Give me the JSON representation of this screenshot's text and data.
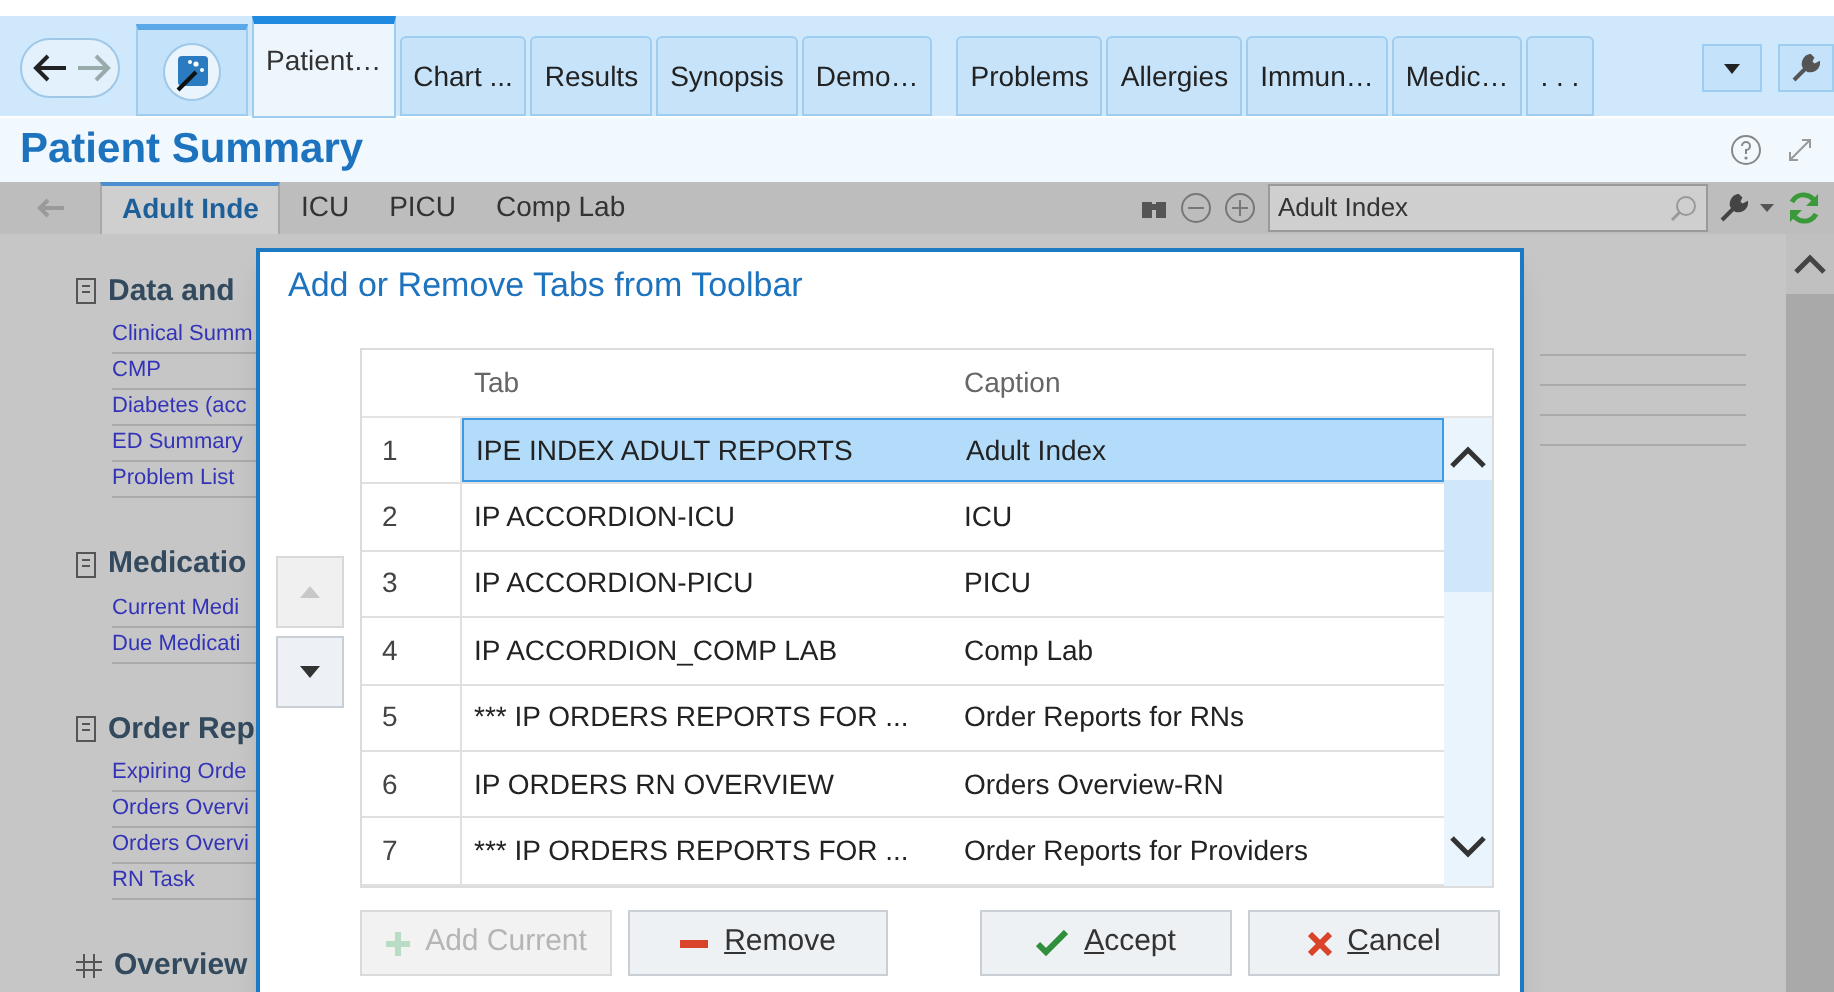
{
  "top_tabs": [
    {
      "label": "Patient…",
      "selected": true
    },
    {
      "label": "Chart ...",
      "selected": false
    },
    {
      "label": "Results",
      "selected": false
    },
    {
      "label": "Synopsis",
      "selected": false
    },
    {
      "label": "Demo…",
      "selected": false
    },
    {
      "label": "Problems",
      "selected": false
    },
    {
      "label": "Allergies",
      "selected": false
    },
    {
      "label": "Immun…",
      "selected": false
    },
    {
      "label": "Medic…",
      "selected": false
    },
    {
      "label": ". . .",
      "selected": false
    }
  ],
  "page_title": "Patient Summary",
  "sub_tabs": [
    {
      "label": "Adult Inde",
      "selected": true
    },
    {
      "label": "ICU",
      "selected": false
    },
    {
      "label": "PICU",
      "selected": false
    },
    {
      "label": "Comp Lab",
      "selected": false
    }
  ],
  "search": {
    "value": "Adult Index"
  },
  "sections": [
    {
      "title": "Data and",
      "kind": "document",
      "links": [
        "Clinical Summ",
        "CMP",
        "Diabetes (acc",
        "ED Summary",
        "Problem List"
      ]
    },
    {
      "title": "Medicatio",
      "kind": "document",
      "links": [
        "Current Medi",
        "Due Medicati"
      ]
    },
    {
      "title": "Order Rep",
      "kind": "document",
      "links": [
        "Expiring Orde",
        "Orders Overvi",
        "Orders Overvi",
        "RN Task"
      ]
    },
    {
      "title": "Overview",
      "kind": "grid"
    }
  ],
  "dialog": {
    "title": "Add or Remove Tabs from Toolbar",
    "columns": [
      "Tab",
      "Caption"
    ],
    "rows": [
      {
        "number": "1",
        "tab": "IPE INDEX ADULT REPORTS",
        "caption": "Adult Index",
        "selected": true
      },
      {
        "number": "2",
        "tab": "IP ACCORDION-ICU",
        "caption": "ICU",
        "selected": false
      },
      {
        "number": "3",
        "tab": "IP ACCORDION-PICU",
        "caption": "PICU",
        "selected": false
      },
      {
        "number": "4",
        "tab": "IP ACCORDION_COMP LAB",
        "caption": "Comp Lab",
        "selected": false
      },
      {
        "number": "5",
        "tab": "*** IP ORDERS REPORTS FOR ...",
        "caption": "Order Reports for RNs",
        "selected": false
      },
      {
        "number": "6",
        "tab": "IP ORDERS RN OVERVIEW",
        "caption": "Orders Overview-RN",
        "selected": false
      },
      {
        "number": "7",
        "tab": "*** IP ORDERS REPORTS FOR ...",
        "caption": "Order Reports for Providers",
        "selected": false
      }
    ],
    "move_up": {
      "disabled": true
    },
    "move_down": {
      "disabled": false
    },
    "buttons": [
      {
        "label": "Add Current",
        "kind": "add",
        "disabled": true,
        "underline_first": false
      },
      {
        "label": "Remove",
        "kind": "remove",
        "disabled": false,
        "underline_first": true
      },
      {
        "label": "Accept",
        "kind": "accept",
        "disabled": false,
        "underline_first": true
      },
      {
        "label": "Cancel",
        "kind": "cancel",
        "disabled": false,
        "underline_first": true
      }
    ]
  }
}
